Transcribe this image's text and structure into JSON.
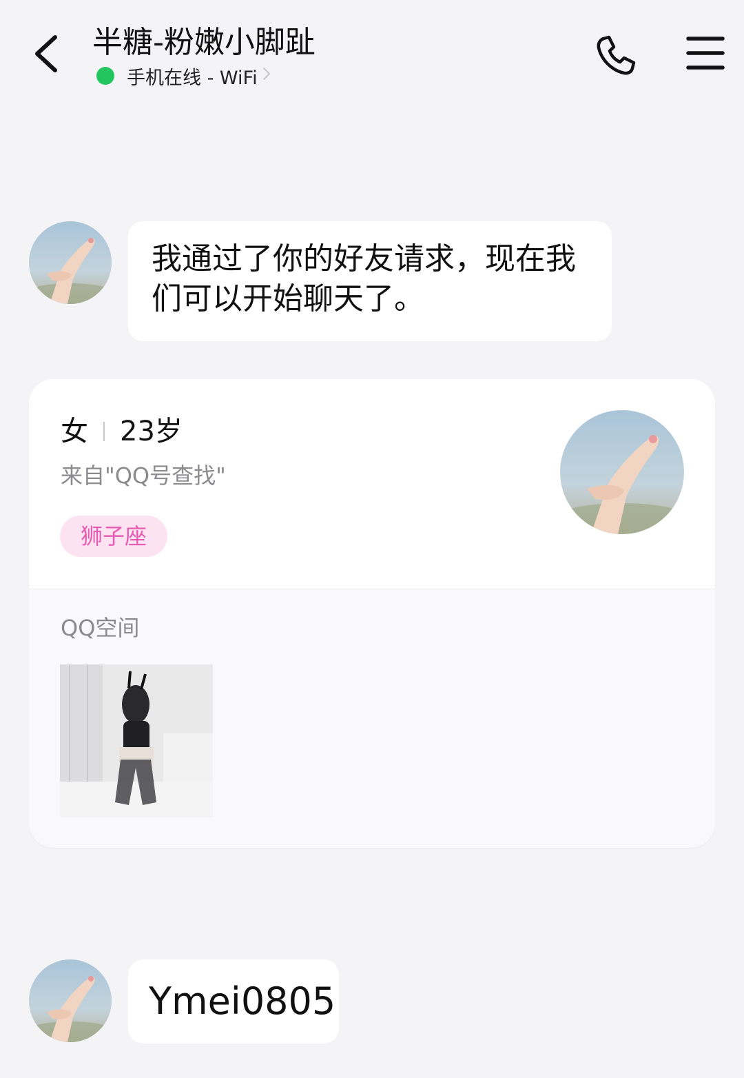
{
  "header": {
    "title": "半糖-粉嫩小脚趾",
    "status": "手机在线 - WiFi",
    "status_color": "#22c55e",
    "back_icon": "chevron-left-icon",
    "call_icon": "phone-icon",
    "menu_icon": "hamburger-menu-icon"
  },
  "messages": [
    {
      "sender": "contact",
      "text": "我通过了你的好友请求，现在我们可以开始聊天了。"
    },
    {
      "sender": "contact",
      "text": "Ymei0805"
    }
  ],
  "profile_card": {
    "gender": "女",
    "age": "23岁",
    "source": "来自\"QQ号查找\"",
    "tag": "狮子座",
    "tag_color": "#e65cb2",
    "qzone_title": "QQ空间"
  }
}
